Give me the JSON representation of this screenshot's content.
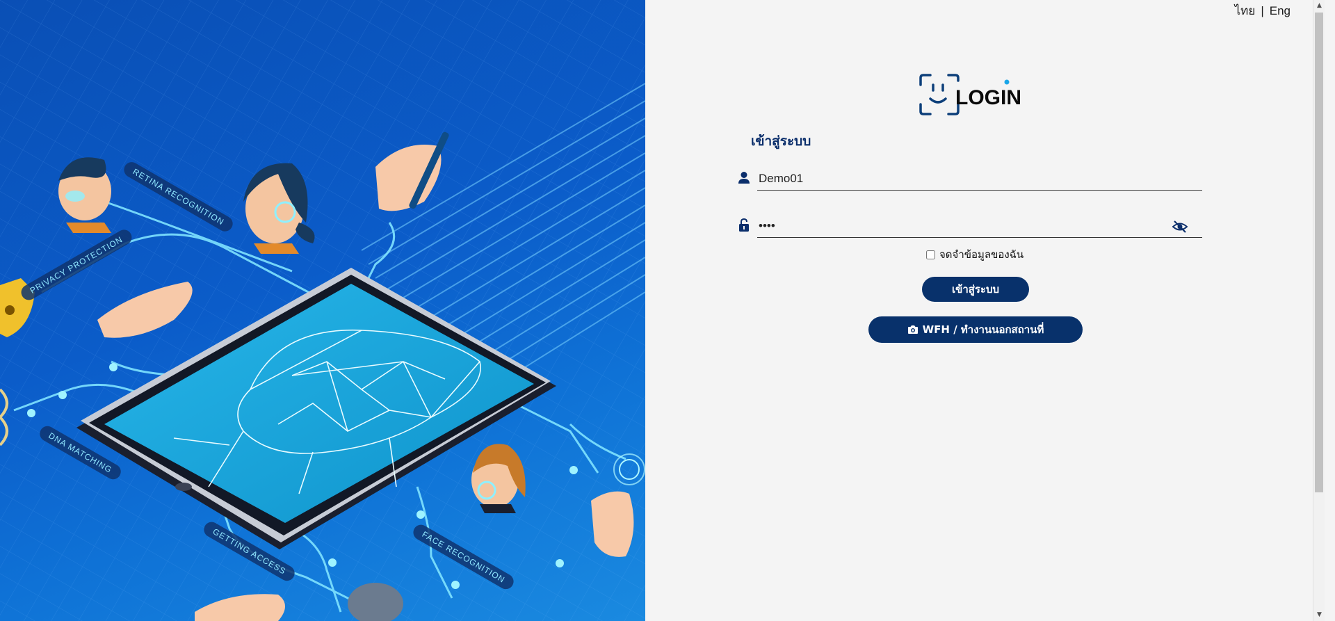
{
  "language": {
    "thai": "ไทย",
    "separator": "|",
    "english": "Eng"
  },
  "logo": {
    "text": "LOGIN",
    "icon": "face-scan-icon"
  },
  "form": {
    "title": "เข้าสู่ระบบ",
    "username": {
      "icon": "user-icon",
      "value": "Demo01"
    },
    "password": {
      "icon": "unlock-icon",
      "value": "••••",
      "toggle_icon": "eye-slash-icon"
    },
    "remember_label": "จดจำข้อมูลของฉัน",
    "login_button": "เข้าสู่ระบบ",
    "wfh_button": "WFH / ทำงานนอกสถานที่",
    "wfh_icon": "camera-icon"
  },
  "illustration": {
    "labels": {
      "retina": "RETINA RECOGNITION",
      "privacy": "PRIVACY PROTECTION",
      "dna": "DNA MATCHING",
      "access": "GETTING ACCESS",
      "face": "FACE RECOGNITION"
    }
  },
  "colors": {
    "primary": "#08316b",
    "background": "#f4f4f4",
    "hero_blue": "#0b5cc9",
    "accent_cyan": "#3fd8ff"
  }
}
